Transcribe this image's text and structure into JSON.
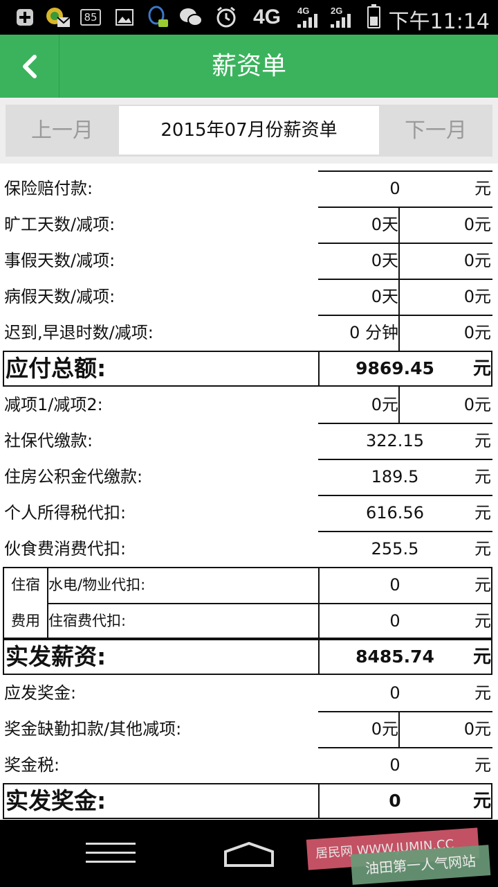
{
  "status_bar": {
    "badge_count": "85",
    "network": "4G",
    "sim1_type": "4G",
    "sim2_type": "2G",
    "battery_level": 0.45,
    "time": "下午11:14"
  },
  "header": {
    "title": "薪资单",
    "back_icon": "chevron-left-icon"
  },
  "month_nav": {
    "prev_label": "上一月",
    "current_label": "2015年07月份薪资单",
    "next_label": "下一月"
  },
  "rows": {
    "insurance": {
      "label": "保险赔付款:",
      "value": "0",
      "unit": "元"
    },
    "absence": {
      "label": "旷工天数/减项:",
      "value1": "0天",
      "value2": "0元"
    },
    "leave": {
      "label": "事假天数/减项:",
      "value1": "0天",
      "value2": "0元"
    },
    "sick": {
      "label": "病假天数/减项:",
      "value1": "0天",
      "value2": "0元"
    },
    "late": {
      "label": "迟到,早退时数/减项:",
      "value1": "0 分钟",
      "value2": "0元"
    },
    "gross_total": {
      "label": "应付总额:",
      "value": "9869.45",
      "unit": "元"
    },
    "deduction": {
      "label": "减项1/减项2:",
      "value1": "0元",
      "value2": "0元"
    },
    "social_security": {
      "label": "社保代缴款:",
      "value": "322.15",
      "unit": "元"
    },
    "housing_fund": {
      "label": "住房公积金代缴款:",
      "value": "189.5",
      "unit": "元"
    },
    "income_tax": {
      "label": "个人所得税代扣:",
      "value": "616.56",
      "unit": "元"
    },
    "meals": {
      "label": "伙食费消费代扣:",
      "value": "255.5",
      "unit": "元"
    },
    "housing": {
      "group_line1": "住宿",
      "group_line2": "费用",
      "utilities": {
        "label": "水电/物业代扣:",
        "value": "0",
        "unit": "元"
      },
      "lodging": {
        "label": "住宿费代扣:",
        "value": "0",
        "unit": "元"
      }
    },
    "net_pay": {
      "label": "实发薪资:",
      "value": "8485.74",
      "unit": "元"
    },
    "bonus_due": {
      "label": "应发奖金:",
      "value": "0",
      "unit": "元"
    },
    "bonus_deduction": {
      "label": "奖金缺勤扣款/其他减项:",
      "value1": "0元",
      "value2": "0元"
    },
    "bonus_tax": {
      "label": "奖金税:",
      "value": "0",
      "unit": "元"
    },
    "net_bonus": {
      "label": "实发奖金:",
      "value": "0",
      "unit": "元"
    }
  },
  "watermark": {
    "line1": "居民网 WWW.JUMIN.CC",
    "line2": "油田第一人气网站"
  },
  "colors": {
    "header_green": "#3bb35d",
    "nav_gray": "#dddddd"
  }
}
